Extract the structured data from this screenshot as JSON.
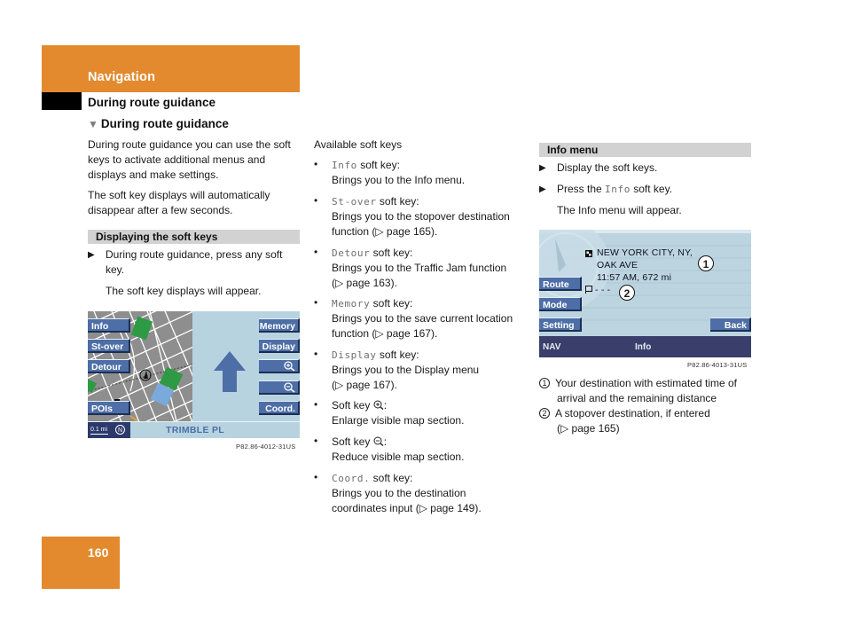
{
  "header": {
    "chapter": "Navigation",
    "section": "During route guidance",
    "subsection": "During route guidance",
    "subsection_icon": "down-triangle"
  },
  "col1": {
    "intro": [
      "During route guidance you can use the soft",
      "keys to activate additional menus and",
      "displays and make settings."
    ],
    "auto_hide": [
      "The soft key displays will automatically",
      "disappear after a few seconds."
    ],
    "bar_title": "Displaying the soft keys",
    "step1": [
      "During route guidance, press any soft",
      "key."
    ],
    "result": "The soft key displays will appear.",
    "screen": {
      "left_keys": [
        "Info",
        "St-over",
        "Detour",
        "POIs"
      ],
      "right_keys": [
        "Memory",
        "Display",
        "zoom-in-icon",
        "zoom-out-icon",
        "Coord."
      ],
      "scale": "0.1 mi",
      "street": "TRIMBLE PL",
      "compass": "N"
    },
    "caption": "P82.86-4012-31US"
  },
  "col2": {
    "heading": "Available soft keys",
    "items": [
      {
        "key": "Info",
        "suffix": " soft key:",
        "desc": [
          "Brings you to the Info menu."
        ]
      },
      {
        "key": "St-over",
        "suffix": " soft key:",
        "desc": [
          "Brings you to the stopover destination",
          "function (▷ page 165)."
        ]
      },
      {
        "key": "Detour",
        "suffix": " soft key:",
        "desc": [
          "Brings you to the Traffic Jam function",
          "(▷ page 163)."
        ]
      },
      {
        "key": "Memory",
        "suffix": " soft key:",
        "desc": [
          "Brings you to the save current location",
          "function (▷ page 167)."
        ]
      },
      {
        "key": "Display",
        "suffix": " soft key:",
        "desc": [
          "Brings you to the Display menu",
          "(▷ page 167)."
        ]
      },
      {
        "prefix": "Soft key ",
        "icon": "zoom-in-icon",
        "suffix": ":",
        "desc": [
          "Enlarge visible map section."
        ]
      },
      {
        "prefix": "Soft key ",
        "icon": "zoom-out-icon",
        "suffix": ":",
        "desc": [
          "Reduce visible map section."
        ]
      },
      {
        "key": "Coord.",
        "suffix": " soft key:",
        "desc": [
          "Brings you to the destination",
          "coordinates input (▷ page 149)."
        ]
      }
    ]
  },
  "col3": {
    "bar_title": "Info menu",
    "step1": "Display the soft keys.",
    "step2_pre": "Press the ",
    "step2_key": "Info",
    "step2_post": " soft key.",
    "result": "The Info menu will appear.",
    "screen": {
      "destination_lines": [
        "NEW YORK CITY, NY,",
        "OAK AVE",
        "11:57 AM, 672 mi"
      ],
      "stopover": "- - -",
      "left_keys": [
        "Route",
        "Mode",
        "Setting"
      ],
      "right_key": "Back",
      "nav_label": "NAV",
      "menu_label": "Info",
      "callouts": [
        "1",
        "2"
      ]
    },
    "caption": "P82.86-4013-31US",
    "legend": [
      {
        "num": "1",
        "lines": [
          "Your destination with estimated time of",
          "arrival and the remaining distance"
        ]
      },
      {
        "num": "2",
        "lines": [
          "A stopover destination, if entered",
          "(▷ page 165)"
        ]
      }
    ]
  },
  "footer": {
    "page_number": "160"
  },
  "colors": {
    "accent": "#e38a2f",
    "softkey": "#4d6ea6",
    "navbar": "#393f6a",
    "screen_bg": "#b8d3e0"
  }
}
